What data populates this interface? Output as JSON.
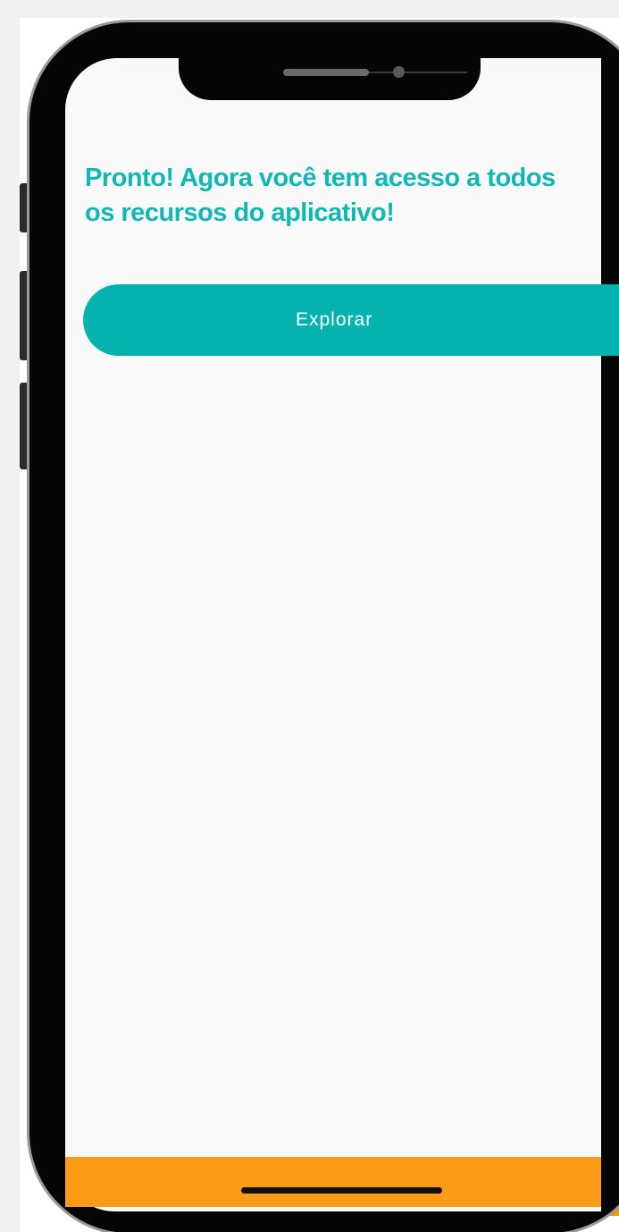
{
  "screen": {
    "headline": "Pronto! Agora você tem acesso a todos os recursos do aplicativo!",
    "explore_button_label": "Explorar"
  },
  "icons": {
    "camera": "front-camera-icon",
    "speaker": "earpiece-speaker-icon",
    "home_indicator": "home-indicator-bar"
  },
  "colors": {
    "accent_teal": "#04b2ae",
    "headline_teal": "#11b7b3",
    "bottom_bar_orange": "#fb9b16",
    "screen_background": "#f9f9f9",
    "frame": "#050505"
  }
}
